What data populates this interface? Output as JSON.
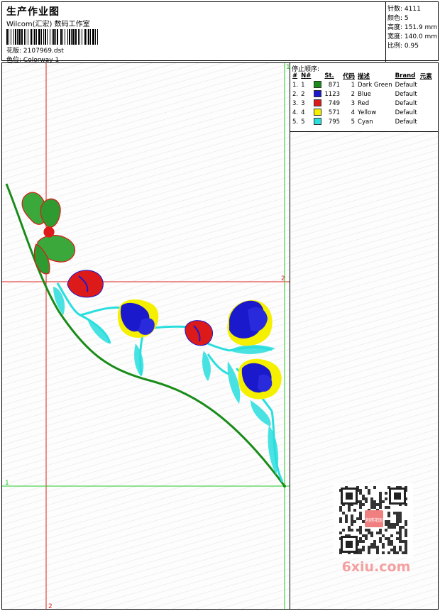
{
  "header": {
    "title": "生产作业图",
    "studio": "Wilcom(汇宏) 数码工作室",
    "design_label": "花版:",
    "design_file": "2107969.dst",
    "colorway_label": "色位:",
    "colorway": "Colorway 1"
  },
  "stats": [
    {
      "label": "针数:",
      "value": "4111"
    },
    {
      "label": "颜色:",
      "value": "5"
    },
    {
      "label": "高度:",
      "value": "151.9 mm"
    },
    {
      "label": "宽度:",
      "value": "140.0 mm"
    },
    {
      "label": "比例:",
      "value": "0.95"
    }
  ],
  "stop_sequence": {
    "title": "停止顺序:",
    "columns": [
      "#",
      "N#",
      "St.",
      "代码",
      "描述",
      "Brand",
      "元素"
    ],
    "rows": [
      {
        "index": "1.",
        "n": "1",
        "color": "#1a8c1a",
        "stitches": "871",
        "code": "1",
        "description": "Dark Green",
        "brand": "Default"
      },
      {
        "index": "2.",
        "n": "2",
        "color": "#1a1acc",
        "stitches": "1123",
        "code": "2",
        "description": "Blue",
        "brand": "Default"
      },
      {
        "index": "3.",
        "n": "3",
        "color": "#dd1a1a",
        "stitches": "749",
        "code": "3",
        "description": "Red",
        "brand": "Default"
      },
      {
        "index": "4.",
        "n": "4",
        "color": "#f5f000",
        "stitches": "571",
        "code": "4",
        "description": "Yellow",
        "brand": "Default"
      },
      {
        "index": "5.",
        "n": "5",
        "color": "#2adede",
        "stitches": "795",
        "code": "5",
        "description": "Cyan",
        "brand": "Default"
      }
    ]
  },
  "guides": {
    "red_h_label": "2",
    "red_v_label": "2",
    "green_h_label": "1",
    "green_v_label": "1"
  },
  "watermark": "6xiu.com",
  "qr_stamp": "刺绣花园",
  "colors": {
    "green": "#1a8c1a",
    "blue": "#1a1acc",
    "red": "#dd1a1a",
    "yellow": "#f5f000",
    "cyan": "#2adede",
    "guide_red": "#e02020",
    "guide_green": "#22cc22"
  }
}
